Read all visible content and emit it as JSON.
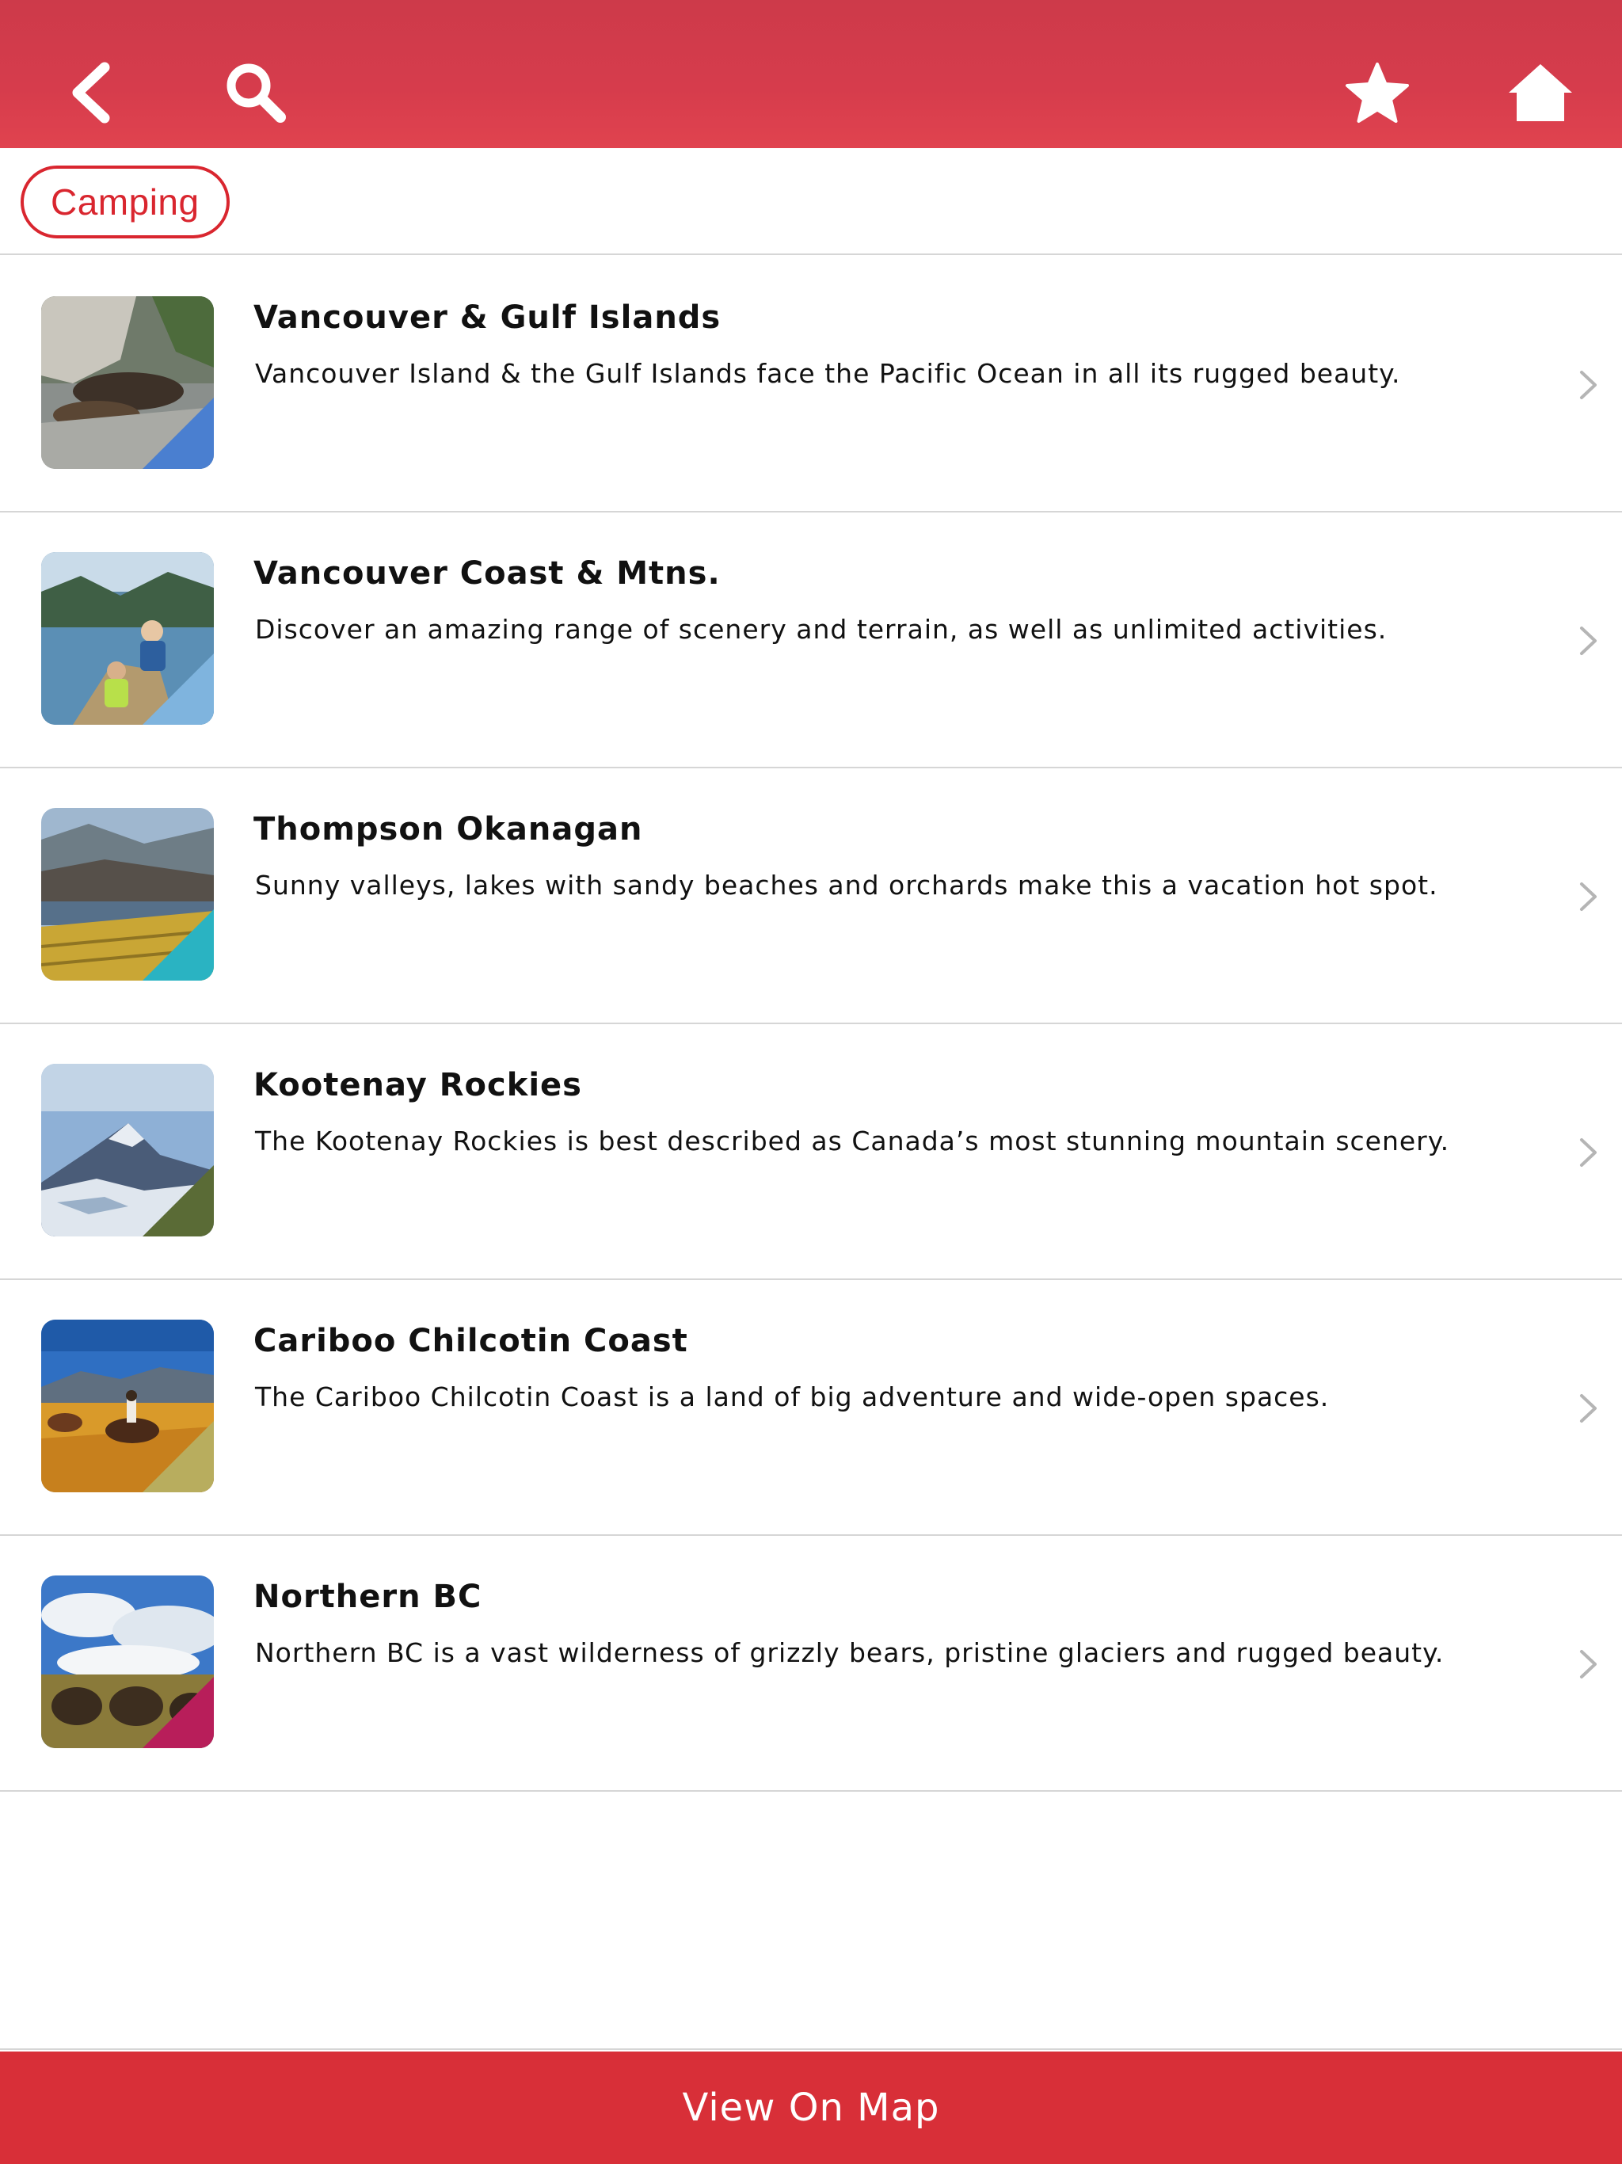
{
  "header": {
    "background_color": "#d63c4c",
    "back_icon": "chevron-left-icon",
    "search_icon": "search-icon",
    "favorites_icon": "star-icon",
    "home_icon": "home-icon"
  },
  "filter": {
    "chip_label": "Camping",
    "chip_color": "#d9262f"
  },
  "regions": [
    {
      "title": "Vancouver & Gulf Islands",
      "description": "Vancouver Island & the Gulf Islands face the Pacific Ocean in all its rugged beauty.",
      "corner_color": "#4a7fd0"
    },
    {
      "title": "Vancouver Coast & Mtns.",
      "description": "Discover an amazing range of scenery and terrain, as well as unlimited activities.",
      "corner_color": "#7fb4de"
    },
    {
      "title": "Thompson Okanagan",
      "description": "Sunny valleys, lakes with sandy beaches and orchards make this a vacation hot spot.",
      "corner_color": "#2ab3c2"
    },
    {
      "title": "Kootenay Rockies",
      "description": "The Kootenay Rockies is best described as Canada’s most stunning mountain scenery.",
      "corner_color": "#5a6b36"
    },
    {
      "title": "Cariboo Chilcotin Coast",
      "description": "The Cariboo Chilcotin Coast is a land of big adventure and wide-open spaces.",
      "corner_color": "#b8ad5e"
    },
    {
      "title": "Northern BC",
      "description": "Northern BC is a vast wilderness of grizzly bears, pristine glaciers and rugged beauty.",
      "corner_color": "#b81e5a"
    }
  ],
  "footer": {
    "map_button_label": "View On Map",
    "button_color": "#d82f38"
  }
}
